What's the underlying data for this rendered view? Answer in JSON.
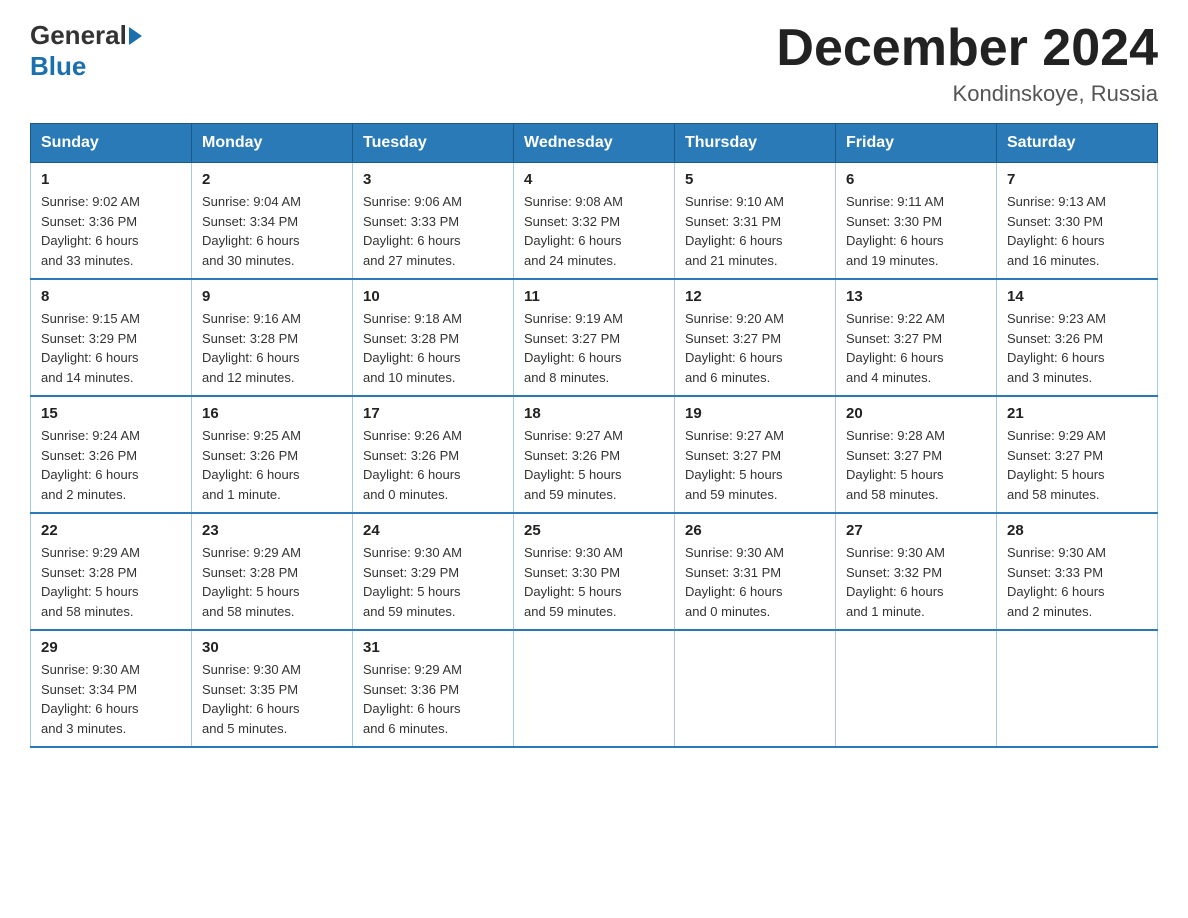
{
  "header": {
    "logo_general": "General",
    "logo_blue": "Blue",
    "title": "December 2024",
    "subtitle": "Kondinskoye, Russia"
  },
  "days_of_week": [
    "Sunday",
    "Monday",
    "Tuesday",
    "Wednesday",
    "Thursday",
    "Friday",
    "Saturday"
  ],
  "weeks": [
    [
      {
        "day": "1",
        "sunrise": "9:02 AM",
        "sunset": "3:36 PM",
        "daylight": "6 hours and 33 minutes."
      },
      {
        "day": "2",
        "sunrise": "9:04 AM",
        "sunset": "3:34 PM",
        "daylight": "6 hours and 30 minutes."
      },
      {
        "day": "3",
        "sunrise": "9:06 AM",
        "sunset": "3:33 PM",
        "daylight": "6 hours and 27 minutes."
      },
      {
        "day": "4",
        "sunrise": "9:08 AM",
        "sunset": "3:32 PM",
        "daylight": "6 hours and 24 minutes."
      },
      {
        "day": "5",
        "sunrise": "9:10 AM",
        "sunset": "3:31 PM",
        "daylight": "6 hours and 21 minutes."
      },
      {
        "day": "6",
        "sunrise": "9:11 AM",
        "sunset": "3:30 PM",
        "daylight": "6 hours and 19 minutes."
      },
      {
        "day": "7",
        "sunrise": "9:13 AM",
        "sunset": "3:30 PM",
        "daylight": "6 hours and 16 minutes."
      }
    ],
    [
      {
        "day": "8",
        "sunrise": "9:15 AM",
        "sunset": "3:29 PM",
        "daylight": "6 hours and 14 minutes."
      },
      {
        "day": "9",
        "sunrise": "9:16 AM",
        "sunset": "3:28 PM",
        "daylight": "6 hours and 12 minutes."
      },
      {
        "day": "10",
        "sunrise": "9:18 AM",
        "sunset": "3:28 PM",
        "daylight": "6 hours and 10 minutes."
      },
      {
        "day": "11",
        "sunrise": "9:19 AM",
        "sunset": "3:27 PM",
        "daylight": "6 hours and 8 minutes."
      },
      {
        "day": "12",
        "sunrise": "9:20 AM",
        "sunset": "3:27 PM",
        "daylight": "6 hours and 6 minutes."
      },
      {
        "day": "13",
        "sunrise": "9:22 AM",
        "sunset": "3:27 PM",
        "daylight": "6 hours and 4 minutes."
      },
      {
        "day": "14",
        "sunrise": "9:23 AM",
        "sunset": "3:26 PM",
        "daylight": "6 hours and 3 minutes."
      }
    ],
    [
      {
        "day": "15",
        "sunrise": "9:24 AM",
        "sunset": "3:26 PM",
        "daylight": "6 hours and 2 minutes."
      },
      {
        "day": "16",
        "sunrise": "9:25 AM",
        "sunset": "3:26 PM",
        "daylight": "6 hours and 1 minute."
      },
      {
        "day": "17",
        "sunrise": "9:26 AM",
        "sunset": "3:26 PM",
        "daylight": "6 hours and 0 minutes."
      },
      {
        "day": "18",
        "sunrise": "9:27 AM",
        "sunset": "3:26 PM",
        "daylight": "5 hours and 59 minutes."
      },
      {
        "day": "19",
        "sunrise": "9:27 AM",
        "sunset": "3:27 PM",
        "daylight": "5 hours and 59 minutes."
      },
      {
        "day": "20",
        "sunrise": "9:28 AM",
        "sunset": "3:27 PM",
        "daylight": "5 hours and 58 minutes."
      },
      {
        "day": "21",
        "sunrise": "9:29 AM",
        "sunset": "3:27 PM",
        "daylight": "5 hours and 58 minutes."
      }
    ],
    [
      {
        "day": "22",
        "sunrise": "9:29 AM",
        "sunset": "3:28 PM",
        "daylight": "5 hours and 58 minutes."
      },
      {
        "day": "23",
        "sunrise": "9:29 AM",
        "sunset": "3:28 PM",
        "daylight": "5 hours and 58 minutes."
      },
      {
        "day": "24",
        "sunrise": "9:30 AM",
        "sunset": "3:29 PM",
        "daylight": "5 hours and 59 minutes."
      },
      {
        "day": "25",
        "sunrise": "9:30 AM",
        "sunset": "3:30 PM",
        "daylight": "5 hours and 59 minutes."
      },
      {
        "day": "26",
        "sunrise": "9:30 AM",
        "sunset": "3:31 PM",
        "daylight": "6 hours and 0 minutes."
      },
      {
        "day": "27",
        "sunrise": "9:30 AM",
        "sunset": "3:32 PM",
        "daylight": "6 hours and 1 minute."
      },
      {
        "day": "28",
        "sunrise": "9:30 AM",
        "sunset": "3:33 PM",
        "daylight": "6 hours and 2 minutes."
      }
    ],
    [
      {
        "day": "29",
        "sunrise": "9:30 AM",
        "sunset": "3:34 PM",
        "daylight": "6 hours and 3 minutes."
      },
      {
        "day": "30",
        "sunrise": "9:30 AM",
        "sunset": "3:35 PM",
        "daylight": "6 hours and 5 minutes."
      },
      {
        "day": "31",
        "sunrise": "9:29 AM",
        "sunset": "3:36 PM",
        "daylight": "6 hours and 6 minutes."
      },
      null,
      null,
      null,
      null
    ]
  ],
  "labels": {
    "sunrise": "Sunrise:",
    "sunset": "Sunset:",
    "daylight": "Daylight:"
  }
}
